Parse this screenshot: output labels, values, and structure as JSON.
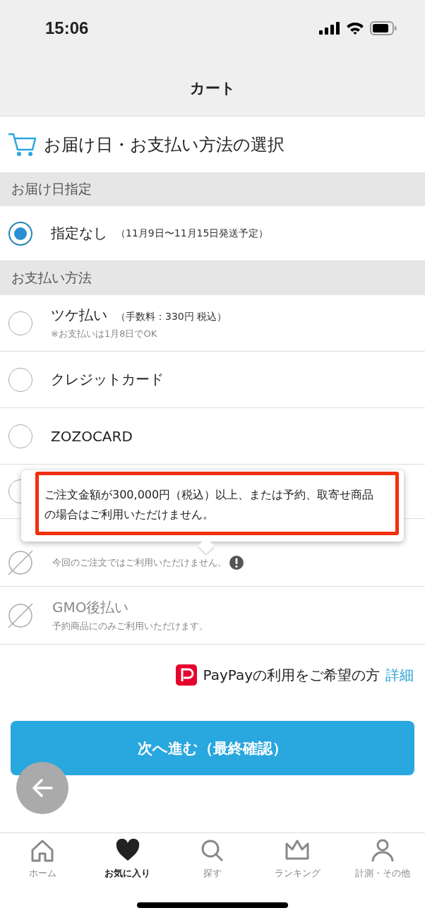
{
  "status_bar": {
    "time": "15:06"
  },
  "header": {
    "title": "カート"
  },
  "page_title": "お届け日・お支払い方法の選択",
  "delivery": {
    "heading": "お届け日指定",
    "options": [
      {
        "label": "指定なし",
        "note": "（11月9日〜11月15日発送予定）",
        "selected": true
      }
    ]
  },
  "payment": {
    "heading": "お支払い方法",
    "options": [
      {
        "kind": "radio",
        "label": "ツケ払い",
        "note": "（手数料：330円 税込）",
        "sub": "※お支払いは1月8日でOK",
        "selected": false
      },
      {
        "kind": "radio",
        "label": "クレジットカード",
        "selected": false
      },
      {
        "kind": "radio",
        "label": "ZOZOCARD",
        "selected": false
      },
      {
        "kind": "radio",
        "selected": false
      },
      {
        "kind": "unavailable",
        "sub": "今回のご注文ではご利用いただけません。",
        "info": true,
        "selected": false
      },
      {
        "kind": "unavailable",
        "label": "GMO後払い",
        "sub": "予約商品にのみご利用いただけます。",
        "selected": false
      }
    ]
  },
  "tooltip": {
    "text": "ご注文金額が300,000円（税込）以上、または予約、取寄せ商品の場合はご利用いただけません。"
  },
  "paypay": {
    "text": "PayPayの利用をご希望の方",
    "link": "詳細"
  },
  "next_button": "次へ進む（最終確認）",
  "tabs": [
    {
      "kind": "home",
      "label": "ホーム",
      "selected": false
    },
    {
      "kind": "heart",
      "label": "お気に入り",
      "selected": true
    },
    {
      "kind": "search",
      "label": "探す",
      "selected": false
    },
    {
      "kind": "crown",
      "label": "ランキング",
      "selected": false
    },
    {
      "kind": "person",
      "label": "計測・その他",
      "selected": false
    }
  ]
}
